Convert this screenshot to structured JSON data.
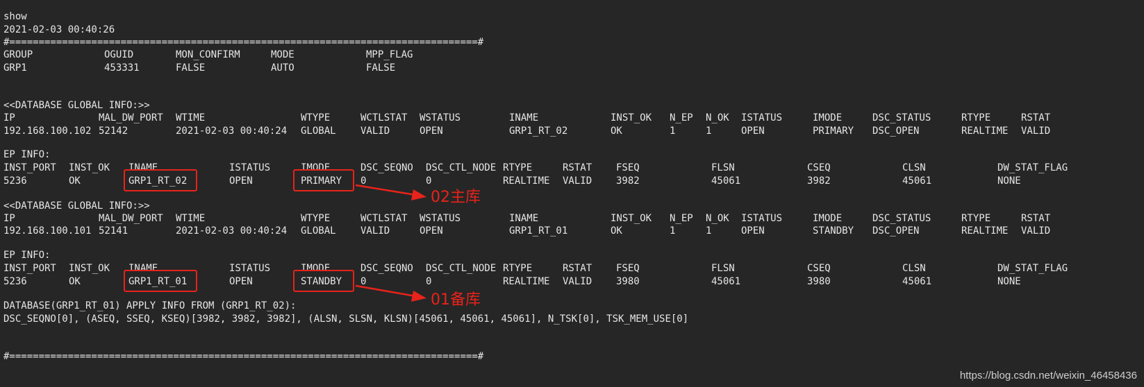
{
  "terminal": {
    "cmd": "show",
    "timestamp": "2021-02-03 00:40:26",
    "separator_top": "#================================================================================#",
    "separator_bottom": "#================================================================================#",
    "group_header": [
      "GROUP",
      "OGUID",
      "MON_CONFIRM",
      "MODE",
      "MPP_FLAG"
    ],
    "group_row": [
      "GRP1",
      "453331",
      "FALSE",
      "AUTO",
      "FALSE"
    ],
    "global_title": "<<DATABASE GLOBAL INFO:>>",
    "global_header": [
      "IP",
      "MAL_DW_PORT",
      "WTIME",
      "WTYPE",
      "WCTLSTAT",
      "WSTATUS",
      "INAME",
      "INST_OK",
      "N_EP",
      "N_OK",
      "ISTATUS",
      "IMODE",
      "DSC_STATUS",
      "RTYPE",
      "RSTAT"
    ],
    "global_row_1": [
      "192.168.100.102",
      "52142",
      "2021-02-03 00:40:24",
      "GLOBAL",
      "VALID",
      "OPEN",
      "GRP1_RT_02",
      "OK",
      "1",
      "1",
      "OPEN",
      "PRIMARY",
      "DSC_OPEN",
      "REALTIME",
      "VALID"
    ],
    "global_row_2": [
      "192.168.100.101",
      "52141",
      "2021-02-03 00:40:24",
      "GLOBAL",
      "VALID",
      "OPEN",
      "GRP1_RT_01",
      "OK",
      "1",
      "1",
      "OPEN",
      "STANDBY",
      "DSC_OPEN",
      "REALTIME",
      "VALID"
    ],
    "ep_title": "EP INFO:",
    "ep_header": [
      "INST_PORT",
      "INST_OK",
      "INAME",
      "ISTATUS",
      "IMODE",
      "DSC_SEQNO",
      "DSC_CTL_NODE",
      "RTYPE",
      "RSTAT",
      "FSEQ",
      "FLSN",
      "CSEQ",
      "CLSN",
      "DW_STAT_FLAG"
    ],
    "ep_row_1": [
      "5236",
      "OK",
      "GRP1_RT_02",
      "OPEN",
      "PRIMARY",
      "0",
      "0",
      "REALTIME",
      "VALID",
      "3982",
      "45061",
      "3982",
      "45061",
      "NONE"
    ],
    "ep_row_2": [
      "5236",
      "OK",
      "GRP1_RT_01",
      "OPEN",
      "STANDBY",
      "0",
      "0",
      "REALTIME",
      "VALID",
      "3980",
      "45061",
      "3980",
      "45061",
      "NONE"
    ],
    "apply_title": "DATABASE(GRP1_RT_01) APPLY INFO FROM (GRP1_RT_02):",
    "apply_detail": "DSC_SEQNO[0], (ASEQ, SSEQ, KSEQ)[3982, 3982, 3982], (ALSN, SLSN, KLSN)[45061, 45061, 45061], N_TSK[0], TSK_MEM_USE[0]"
  },
  "annotations": {
    "primary_label": "02主库",
    "standby_label": "01备库",
    "color": "#e8231b"
  },
  "watermark": "https://blog.csdn.net/weixin_46458436"
}
